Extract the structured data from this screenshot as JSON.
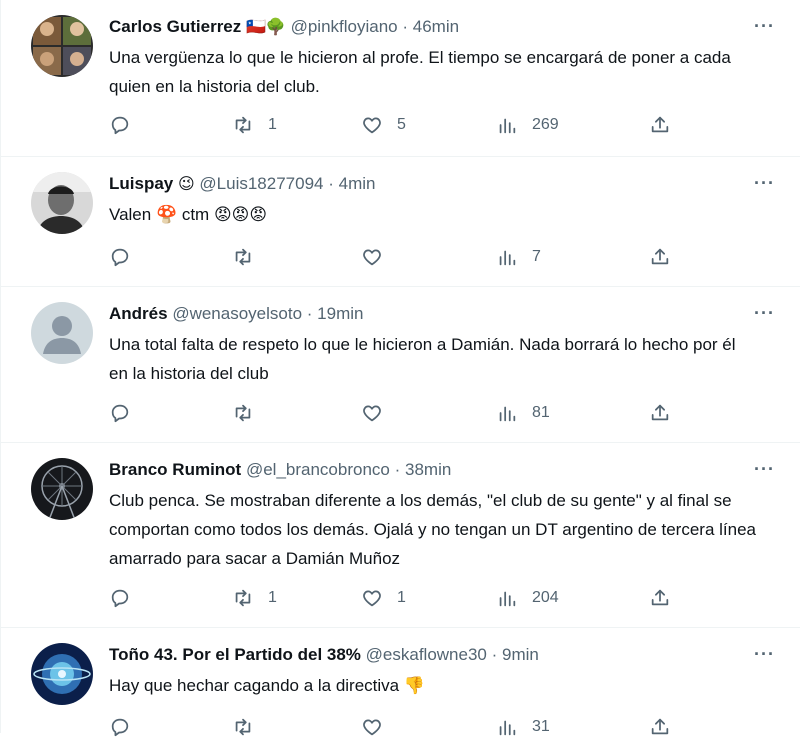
{
  "tweets": [
    {
      "name": "Carlos Gutierrez",
      "badges": "🇨🇱🌳",
      "handle": "@pinkfloyiano",
      "dot": "·",
      "time": "46min",
      "more": "···",
      "text": "Una vergüenza lo que le hicieron al profe. El tiempo se encargará de poner a cada quien en la historia del club.",
      "replies": "",
      "retweets": "1",
      "likes": "5",
      "views": "269",
      "avatar_icon": "collage-avatar-icon"
    },
    {
      "name": "Luispay",
      "badges": "😉",
      "handle": "@Luis18277094",
      "dot": "·",
      "time": "4min",
      "more": "···",
      "text": "Valen 🍄 ctm 😡😡😡",
      "replies": "",
      "retweets": "",
      "likes": "",
      "views": "7",
      "avatar_icon": "person-photo-avatar-icon"
    },
    {
      "name": "Andrés",
      "badges": "",
      "handle": "@wenasoyelsoto",
      "dot": "·",
      "time": "19min",
      "more": "···",
      "text": "Una total falta de respeto lo que le hicieron a Damián. Nada borrará lo hecho por él en la historia del club",
      "replies": "",
      "retweets": "",
      "likes": "",
      "views": "81",
      "avatar_icon": "default-avatar-icon"
    },
    {
      "name": "Branco Ruminot",
      "badges": "",
      "handle": "@el_brancobronco",
      "dot": "·",
      "time": "38min",
      "more": "···",
      "text": "Club penca. Se mostraban diferente a los demás, \"el club de su gente\" y al final se comportan como todos los demás. Ojalá y no tengan un DT argentino de tercera línea amarrado para sacar a Damián Muñoz",
      "replies": "",
      "retweets": "1",
      "likes": "1",
      "views": "204",
      "avatar_icon": "ferris-wheel-avatar-icon"
    },
    {
      "name": "Toño 43. Por el Partido del 38%",
      "badges": "",
      "handle": "@eskaflowne30",
      "dot": "·",
      "time": "9min",
      "more": "···",
      "text": "Hay que hechar cagando a la directiva 👎",
      "replies": "",
      "retweets": "",
      "likes": "",
      "views": "31",
      "avatar_icon": "planet-avatar-icon"
    }
  ],
  "colors": {
    "text": "#0f1419",
    "secondary": "#536471",
    "border": "#eff3f4"
  }
}
